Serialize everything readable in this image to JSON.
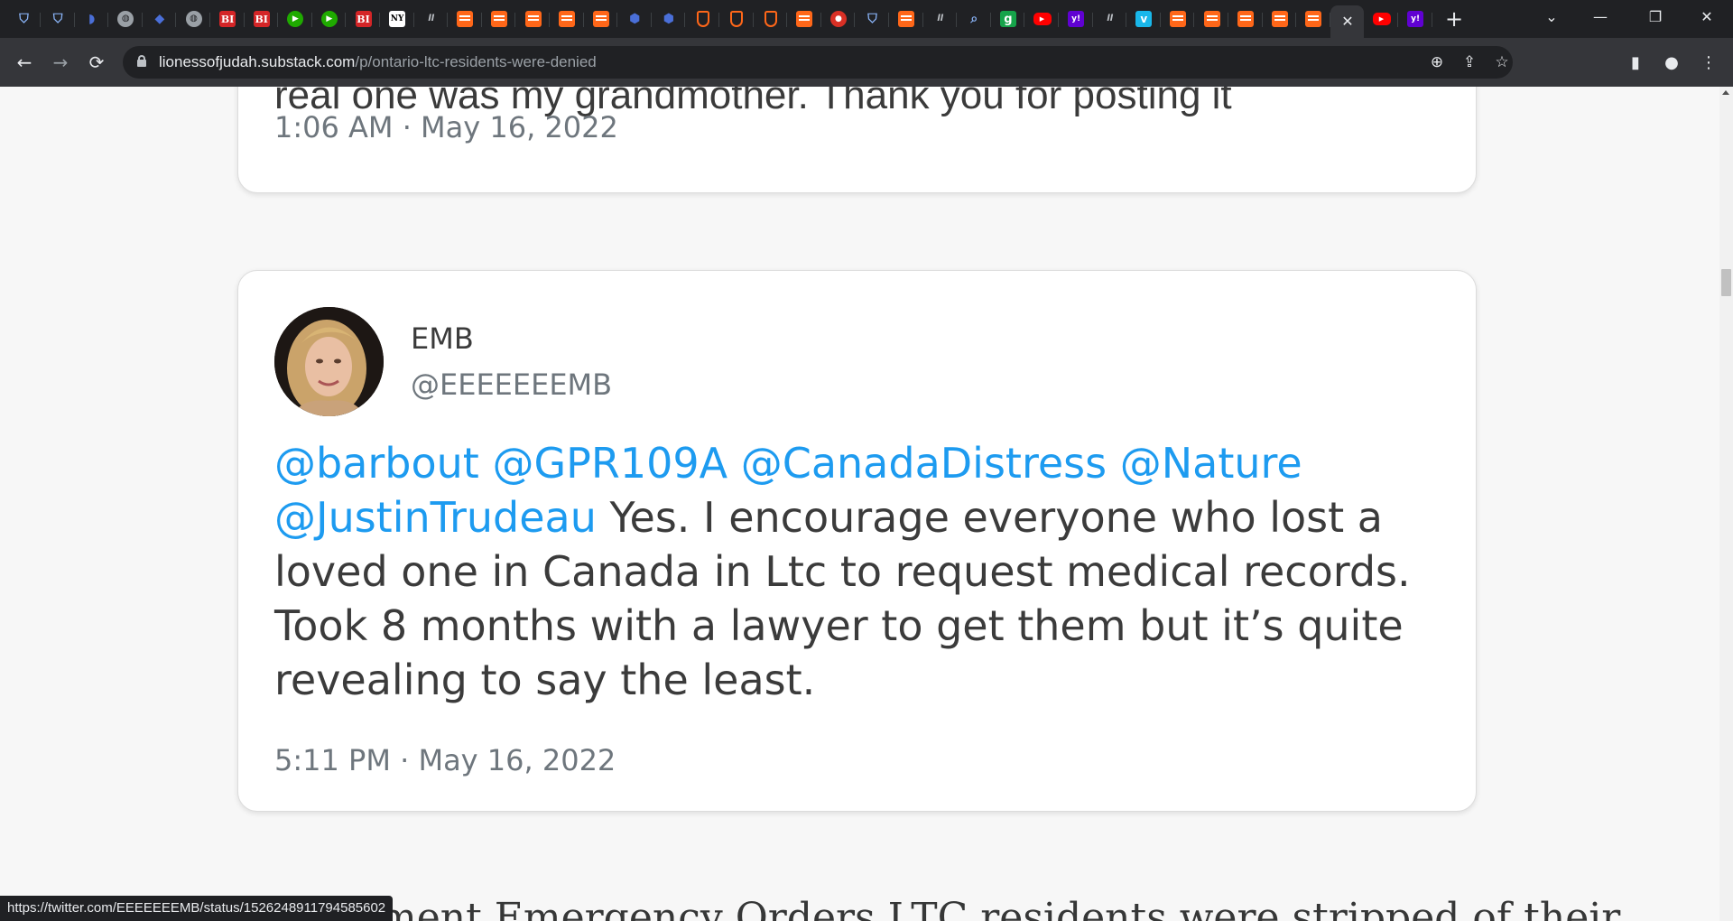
{
  "browser": {
    "tabs": [
      {
        "icon": "shield-icon",
        "glyph": "⛉",
        "kind": "shield"
      },
      {
        "icon": "shield-icon",
        "glyph": "⛉",
        "kind": "shield"
      },
      {
        "icon": "bookmark-icon",
        "glyph": "◗",
        "kind": "dots"
      },
      {
        "icon": "globe-icon",
        "glyph": "◍",
        "kind": "globe"
      },
      {
        "icon": "grad-cap-icon",
        "glyph": "◆",
        "kind": "dots"
      },
      {
        "icon": "globe-icon",
        "glyph": "◍",
        "kind": "globe"
      },
      {
        "icon": "business-insider-icon",
        "glyph": "BI",
        "kind": "bi"
      },
      {
        "icon": "business-insider-icon",
        "glyph": "BI",
        "kind": "bi"
      },
      {
        "icon": "play-icon",
        "glyph": "▶",
        "kind": "play"
      },
      {
        "icon": "play-icon",
        "glyph": "▶",
        "kind": "play"
      },
      {
        "icon": "business-insider-icon",
        "glyph": "BI",
        "kind": "bi"
      },
      {
        "icon": "newspaper-icon",
        "glyph": "NY",
        "kind": "nyt"
      },
      {
        "icon": "ww-icon",
        "glyph": "ll",
        "kind": "ww"
      },
      {
        "icon": "substack-icon",
        "glyph": "",
        "kind": "sub"
      },
      {
        "icon": "substack-icon",
        "glyph": "",
        "kind": "sub"
      },
      {
        "icon": "substack-icon",
        "glyph": "",
        "kind": "sub"
      },
      {
        "icon": "substack-icon",
        "glyph": "",
        "kind": "sub"
      },
      {
        "icon": "substack-icon",
        "glyph": "",
        "kind": "sub"
      },
      {
        "icon": "cube-icon",
        "glyph": "⬢",
        "kind": "dots"
      },
      {
        "icon": "cube-icon",
        "glyph": "⬢",
        "kind": "dots"
      },
      {
        "icon": "badge-icon",
        "glyph": "",
        "kind": "badge"
      },
      {
        "icon": "badge-icon",
        "glyph": "",
        "kind": "badge"
      },
      {
        "icon": "badge-icon",
        "glyph": "",
        "kind": "badge"
      },
      {
        "icon": "substack-icon",
        "glyph": "",
        "kind": "sub"
      },
      {
        "icon": "microphone-icon",
        "glyph": "●",
        "kind": "mic"
      },
      {
        "icon": "shield-icon",
        "glyph": "⛉",
        "kind": "shield"
      },
      {
        "icon": "substack-icon",
        "glyph": "",
        "kind": "sub"
      },
      {
        "icon": "ww-icon",
        "glyph": "ll",
        "kind": "ww"
      },
      {
        "icon": "search-icon",
        "glyph": "⌕",
        "kind": "search"
      },
      {
        "icon": "g-icon",
        "glyph": "g",
        "kind": "g"
      },
      {
        "icon": "youtube-icon",
        "glyph": "▶",
        "kind": "yt"
      },
      {
        "icon": "yahoo-icon",
        "glyph": "y!",
        "kind": "yahoo"
      },
      {
        "icon": "ww-icon",
        "glyph": "ll",
        "kind": "ww"
      },
      {
        "icon": "vimeo-icon",
        "glyph": "v",
        "kind": "vimeo"
      },
      {
        "icon": "substack-icon",
        "glyph": "",
        "kind": "sub"
      },
      {
        "icon": "substack-icon",
        "glyph": "",
        "kind": "sub"
      },
      {
        "icon": "substack-icon",
        "glyph": "",
        "kind": "sub"
      },
      {
        "icon": "substack-icon",
        "glyph": "",
        "kind": "sub"
      },
      {
        "icon": "substack-icon",
        "glyph": "",
        "kind": "sub"
      },
      {
        "icon": "close-icon",
        "glyph": "✕",
        "kind": "close",
        "active": true
      },
      {
        "icon": "youtube-icon",
        "glyph": "▶",
        "kind": "yt"
      },
      {
        "icon": "yahoo-icon",
        "glyph": "y!",
        "kind": "yahoo"
      }
    ],
    "new_tab_glyph": "+",
    "window": {
      "dropdown": "⌄",
      "minimize": "—",
      "restore": "❐",
      "close": "✕"
    },
    "nav": {
      "back": "←",
      "forward": "→",
      "reload": "⟳"
    },
    "url_domain": "lionessofjudah.substack.com",
    "url_path": "/p/ontario-ltc-residents-were-denied",
    "omnibox_icons": {
      "zoom": "⊕",
      "share": "⇪",
      "bookmark": "☆"
    },
    "toolbar_icons": {
      "sidepanel": "▮",
      "profile": "●",
      "menu": "⋮"
    }
  },
  "page": {
    "tweet1": {
      "clipped_text": "real one was my grandmother. Thank you for posting it",
      "timestamp": "1:06 AM · May 16, 2022"
    },
    "tweet2": {
      "name": "EMB",
      "handle": "@EEEEEEEMB",
      "mentions": [
        "@barbout",
        "@GPR109A",
        "@CanadaDistress",
        "@Nature",
        "@JustinTrudeau"
      ],
      "text": "Yes. I encourage everyone who lost a loved one in Canada in Ltc to request medical records. Took 8 months with a lawyer to get them but it’s quite revealing to say the least.",
      "timestamp": "5:11 PM · May 16, 2022"
    },
    "article_clipped_text": "ment Emergency Orders LTC residents were stripped of their"
  },
  "status_bar_url": "https://twitter.com/EEEEEEEMB/status/1526248911794585602",
  "colors": {
    "mention": "#1d9bf0",
    "tab_strip": "#202124",
    "toolbar": "#35363a",
    "substack": "#ff6719"
  }
}
